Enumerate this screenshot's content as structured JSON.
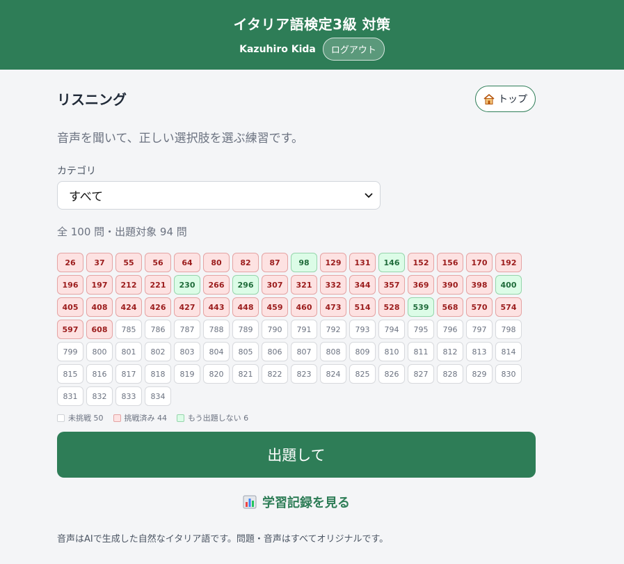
{
  "header": {
    "title": "イタリア語検定3級 対策",
    "user_name": "Kazuhiro Kida",
    "logout_label": "ログアウト"
  },
  "page": {
    "title": "リスニング",
    "top_label": "トップ",
    "top_icon": "house-icon",
    "description": "音声を聞いて、正しい選択肢を選ぶ練習です。",
    "category_label": "カテゴリ",
    "category_selected": "すべて",
    "counts": "全 100 問・出題対象 94 問"
  },
  "questions": [
    {
      "n": "26",
      "s": "tried"
    },
    {
      "n": "37",
      "s": "tried"
    },
    {
      "n": "55",
      "s": "tried"
    },
    {
      "n": "56",
      "s": "tried"
    },
    {
      "n": "64",
      "s": "tried"
    },
    {
      "n": "80",
      "s": "tried"
    },
    {
      "n": "82",
      "s": "tried"
    },
    {
      "n": "87",
      "s": "tried"
    },
    {
      "n": "98",
      "s": "done"
    },
    {
      "n": "129",
      "s": "tried"
    },
    {
      "n": "131",
      "s": "tried"
    },
    {
      "n": "146",
      "s": "done"
    },
    {
      "n": "152",
      "s": "tried"
    },
    {
      "n": "156",
      "s": "tried"
    },
    {
      "n": "170",
      "s": "tried"
    },
    {
      "n": "192",
      "s": "tried"
    },
    {
      "n": "196",
      "s": "tried"
    },
    {
      "n": "197",
      "s": "tried"
    },
    {
      "n": "212",
      "s": "tried"
    },
    {
      "n": "221",
      "s": "tried"
    },
    {
      "n": "230",
      "s": "done"
    },
    {
      "n": "266",
      "s": "tried"
    },
    {
      "n": "296",
      "s": "done"
    },
    {
      "n": "307",
      "s": "tried"
    },
    {
      "n": "321",
      "s": "tried"
    },
    {
      "n": "332",
      "s": "tried"
    },
    {
      "n": "344",
      "s": "tried"
    },
    {
      "n": "357",
      "s": "tried"
    },
    {
      "n": "369",
      "s": "tried"
    },
    {
      "n": "390",
      "s": "tried"
    },
    {
      "n": "398",
      "s": "tried"
    },
    {
      "n": "400",
      "s": "done"
    },
    {
      "n": "405",
      "s": "tried"
    },
    {
      "n": "408",
      "s": "tried"
    },
    {
      "n": "424",
      "s": "tried"
    },
    {
      "n": "426",
      "s": "tried"
    },
    {
      "n": "427",
      "s": "tried"
    },
    {
      "n": "443",
      "s": "tried"
    },
    {
      "n": "448",
      "s": "tried"
    },
    {
      "n": "459",
      "s": "tried"
    },
    {
      "n": "460",
      "s": "tried"
    },
    {
      "n": "473",
      "s": "tried"
    },
    {
      "n": "514",
      "s": "tried"
    },
    {
      "n": "528",
      "s": "tried"
    },
    {
      "n": "539",
      "s": "done"
    },
    {
      "n": "568",
      "s": "tried"
    },
    {
      "n": "570",
      "s": "tried"
    },
    {
      "n": "574",
      "s": "tried"
    },
    {
      "n": "597",
      "s": "tried"
    },
    {
      "n": "608",
      "s": "tried"
    },
    {
      "n": "785",
      "s": "new"
    },
    {
      "n": "786",
      "s": "new"
    },
    {
      "n": "787",
      "s": "new"
    },
    {
      "n": "788",
      "s": "new"
    },
    {
      "n": "789",
      "s": "new"
    },
    {
      "n": "790",
      "s": "new"
    },
    {
      "n": "791",
      "s": "new"
    },
    {
      "n": "792",
      "s": "new"
    },
    {
      "n": "793",
      "s": "new"
    },
    {
      "n": "794",
      "s": "new"
    },
    {
      "n": "795",
      "s": "new"
    },
    {
      "n": "796",
      "s": "new"
    },
    {
      "n": "797",
      "s": "new"
    },
    {
      "n": "798",
      "s": "new"
    },
    {
      "n": "799",
      "s": "new"
    },
    {
      "n": "800",
      "s": "new"
    },
    {
      "n": "801",
      "s": "new"
    },
    {
      "n": "802",
      "s": "new"
    },
    {
      "n": "803",
      "s": "new"
    },
    {
      "n": "804",
      "s": "new"
    },
    {
      "n": "805",
      "s": "new"
    },
    {
      "n": "806",
      "s": "new"
    },
    {
      "n": "807",
      "s": "new"
    },
    {
      "n": "808",
      "s": "new"
    },
    {
      "n": "809",
      "s": "new"
    },
    {
      "n": "810",
      "s": "new"
    },
    {
      "n": "811",
      "s": "new"
    },
    {
      "n": "812",
      "s": "new"
    },
    {
      "n": "813",
      "s": "new"
    },
    {
      "n": "814",
      "s": "new"
    },
    {
      "n": "815",
      "s": "new"
    },
    {
      "n": "816",
      "s": "new"
    },
    {
      "n": "817",
      "s": "new"
    },
    {
      "n": "818",
      "s": "new"
    },
    {
      "n": "819",
      "s": "new"
    },
    {
      "n": "820",
      "s": "new"
    },
    {
      "n": "821",
      "s": "new"
    },
    {
      "n": "822",
      "s": "new"
    },
    {
      "n": "823",
      "s": "new"
    },
    {
      "n": "824",
      "s": "new"
    },
    {
      "n": "825",
      "s": "new"
    },
    {
      "n": "826",
      "s": "new"
    },
    {
      "n": "827",
      "s": "new"
    },
    {
      "n": "828",
      "s": "new"
    },
    {
      "n": "829",
      "s": "new"
    },
    {
      "n": "830",
      "s": "new"
    },
    {
      "n": "831",
      "s": "new"
    },
    {
      "n": "832",
      "s": "new"
    },
    {
      "n": "833",
      "s": "new"
    },
    {
      "n": "834",
      "s": "new"
    }
  ],
  "legend": {
    "new": "未挑戦 50",
    "tried": "挑戦済み 44",
    "done": "もう出題しない 6"
  },
  "actions": {
    "start_label": "出題して",
    "history_label": "学習記録を見る",
    "history_icon": "bar-chart-icon"
  },
  "footer": {
    "note": "音声はAIで生成した自然なイタリア語です。問題・音声はすべてオリジナルです。"
  },
  "colors": {
    "primary": "#2e7d57",
    "tried_bg": "#fde2e2",
    "done_bg": "#dcfce7"
  }
}
